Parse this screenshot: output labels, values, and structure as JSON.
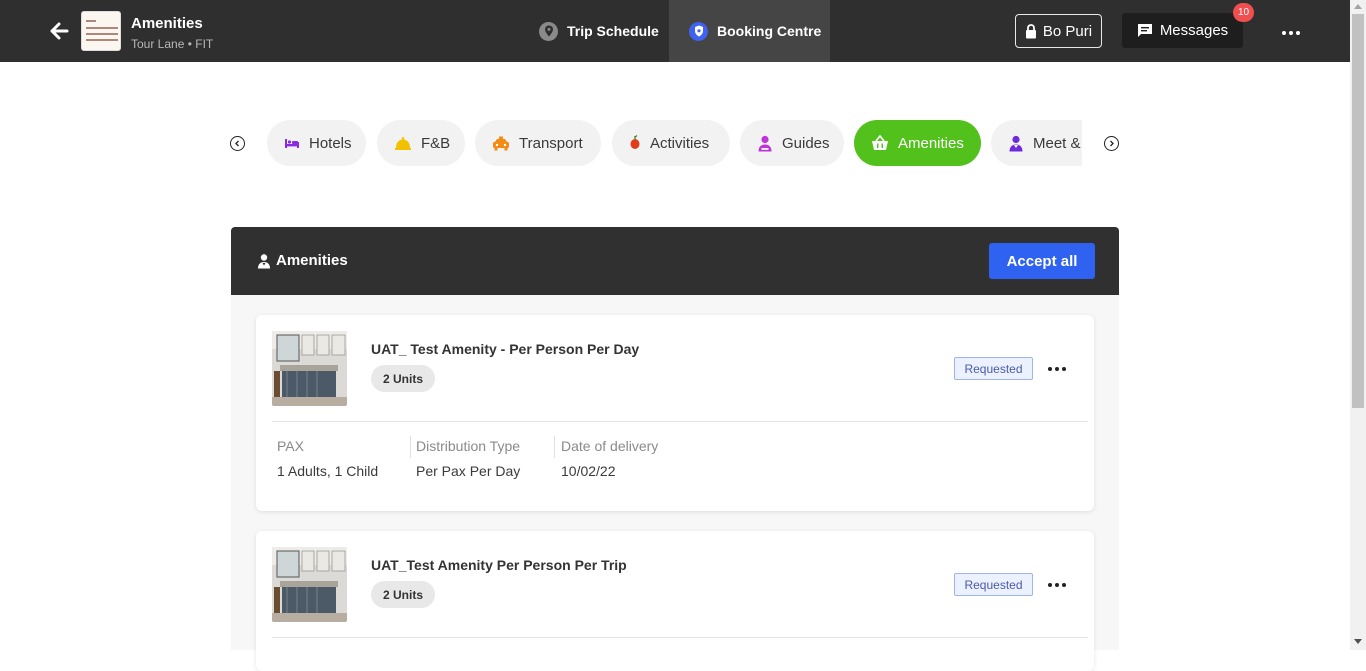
{
  "header": {
    "title": "Amenities",
    "subtitle": "Tour Lane • FIT",
    "tabs": [
      {
        "label": "Trip Schedule",
        "icon": "location-pin-icon"
      },
      {
        "label": "Booking Centre",
        "icon": "shield-icon"
      }
    ],
    "user": "Bo Puri",
    "messages_label": "Messages",
    "messages_badge": "10"
  },
  "categories": [
    {
      "label": "Hotels",
      "icon": "bed-icon",
      "color": "#8a2be2",
      "active": false
    },
    {
      "label": "F&B",
      "icon": "cloche-icon",
      "color": "#f2c200",
      "active": false
    },
    {
      "label": "Transport",
      "icon": "taxi-icon",
      "color": "#f28c13",
      "active": false
    },
    {
      "label": "Activities",
      "icon": "balloon-icon",
      "color": "#e23b1a",
      "active": false
    },
    {
      "label": "Guides",
      "icon": "guide-person-icon",
      "color": "#c033d8",
      "active": false
    },
    {
      "label": "Amenities",
      "icon": "basket-icon",
      "color": "#ffffff",
      "active": true
    },
    {
      "label": "Meet & Greet",
      "icon": "meet-person-icon",
      "color": "#6e2bd9",
      "active": false
    }
  ],
  "panel": {
    "title": "Amenities",
    "accept_all_label": "Accept all"
  },
  "items": [
    {
      "name": "UAT_ Test Amenity - Per Person Per Day",
      "units": "2 Units",
      "status": "Requested",
      "details": [
        {
          "label": "PAX",
          "value": "1 Adults, 1 Child"
        },
        {
          "label": "Distribution Type",
          "value": "Per Pax Per Day"
        },
        {
          "label": "Date of delivery",
          "value": "10/02/22"
        }
      ]
    },
    {
      "name": "UAT_Test Amenity Per Person Per Trip",
      "units": "2 Units",
      "status": "Requested"
    }
  ]
}
